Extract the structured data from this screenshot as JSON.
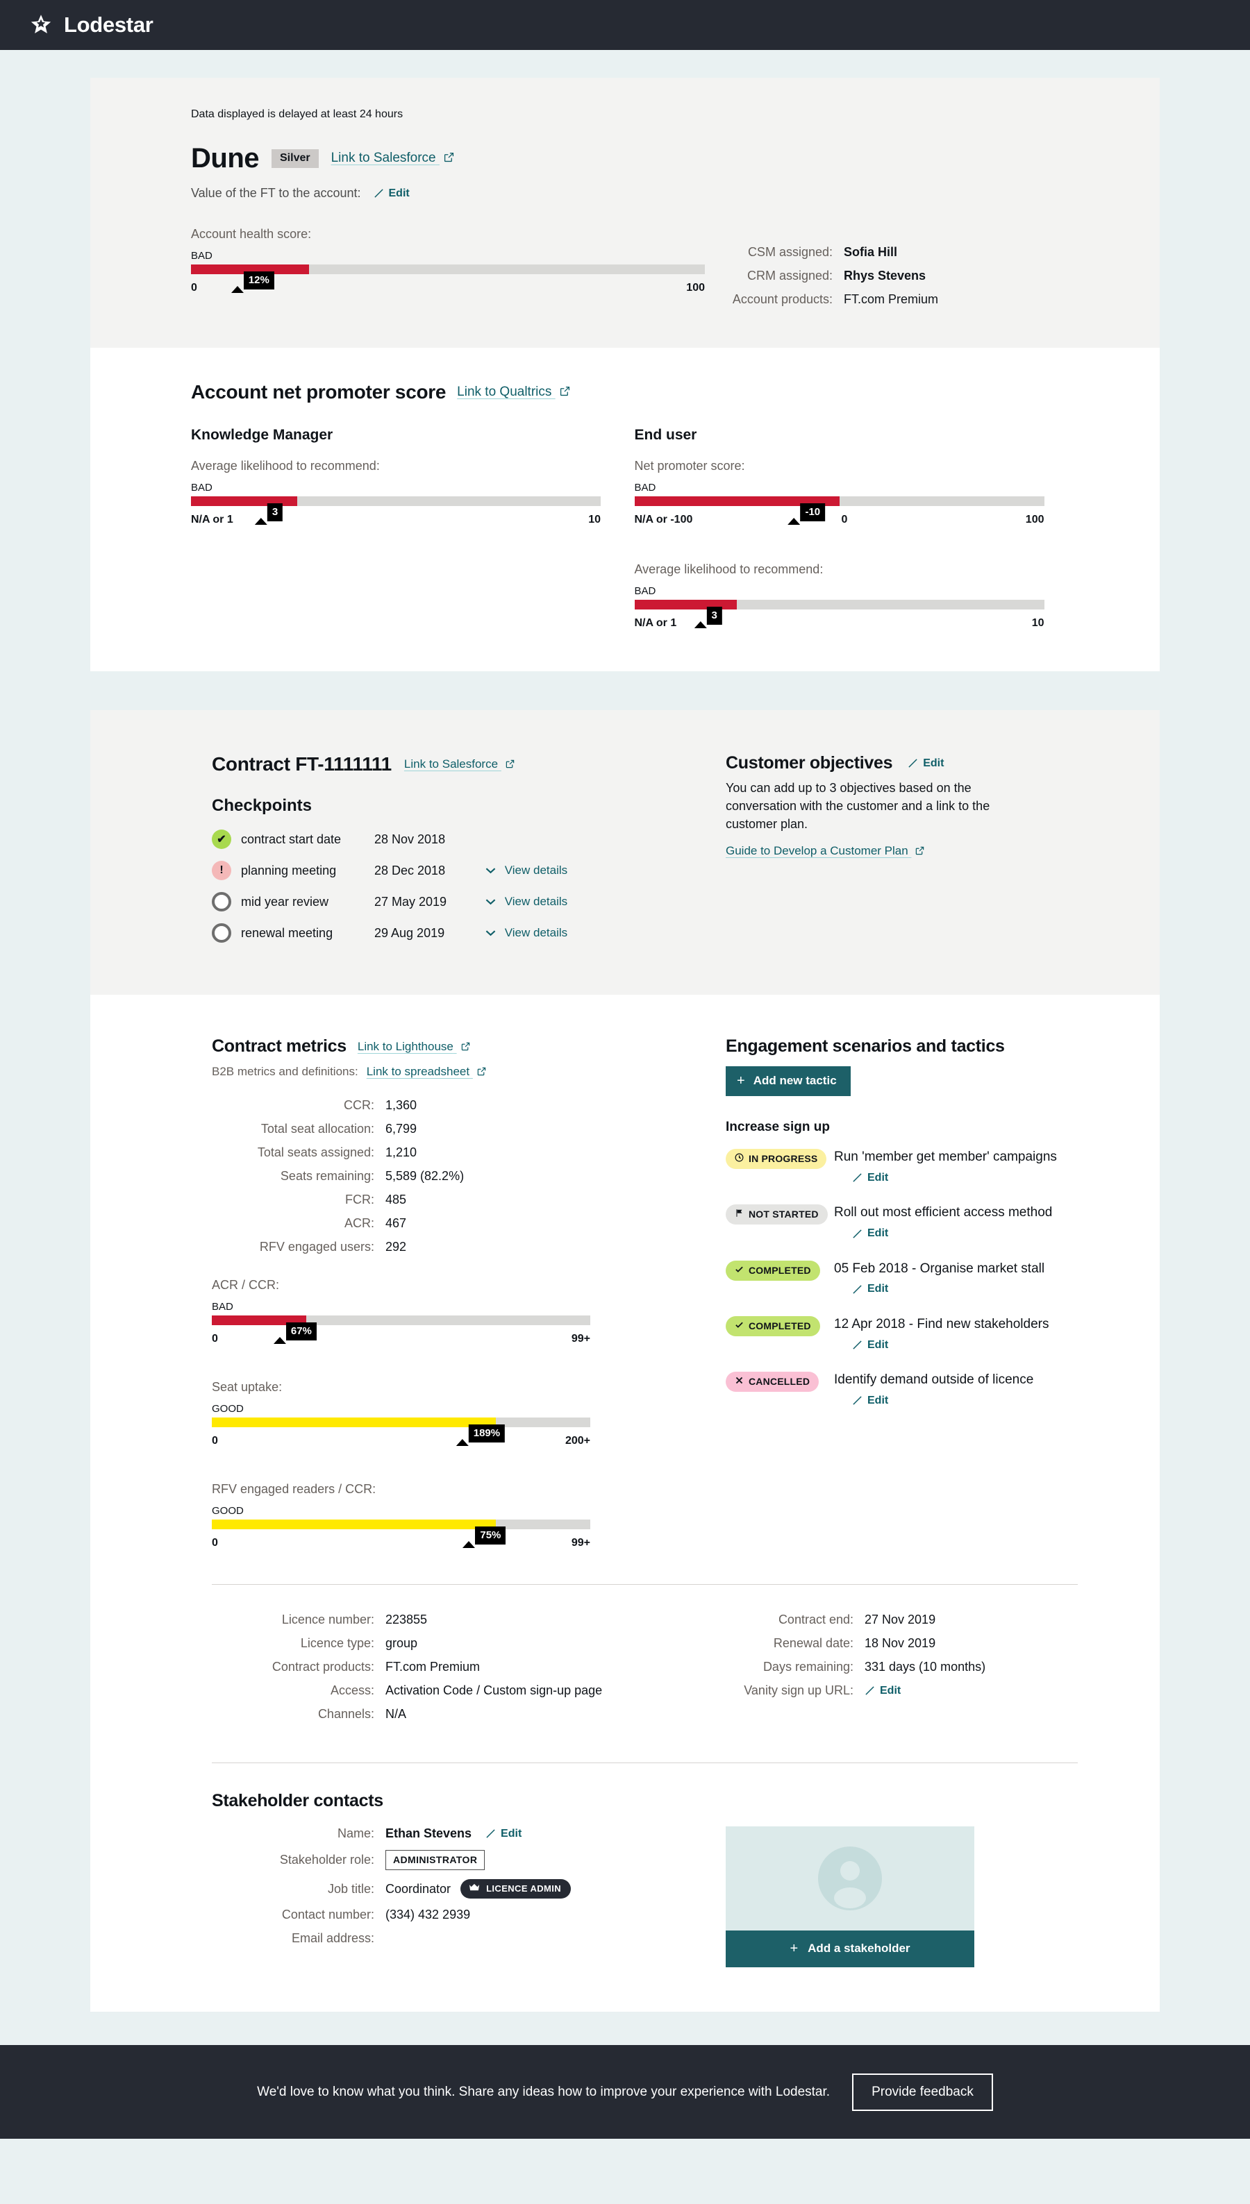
{
  "header": {
    "app_name": "Lodestar",
    "logo_icon": "star-icon"
  },
  "notice": "Data displayed is delayed at least 24 hours",
  "account": {
    "name": "Dune",
    "tier": "Silver",
    "salesforce_link": "Link to Salesforce",
    "value_label": "Value of the FT to the account:",
    "value_edit": "Edit",
    "health_caption": "Account health score:",
    "details": [
      {
        "label": "CSM assigned:",
        "value": "Sofia Hill",
        "bold": true
      },
      {
        "label": "CRM assigned:",
        "value": "Rhys Stevens",
        "bold": true
      },
      {
        "label": "Account products:",
        "value": "FT.com Premium",
        "bold": false
      }
    ]
  },
  "nps": {
    "title": "Account net promoter score",
    "qualtrics_link": "Link to Qualtrics",
    "km_heading": "Knowledge Manager",
    "enduser_heading": "End user",
    "km_caption": "Average likelihood to recommend:",
    "nps_caption": "Net promoter score:",
    "eu_avg_caption": "Average likelihood to recommend:"
  },
  "contract": {
    "title": "Contract FT-1111111",
    "salesforce_link": "Link to Salesforce",
    "checkpoints_heading": "Checkpoints",
    "checkpoints": [
      {
        "status": "done",
        "name": "contract start date",
        "date": "28 Nov 2018",
        "details": ""
      },
      {
        "status": "warn",
        "name": "planning meeting",
        "date": "28 Dec 2018",
        "details": "View details"
      },
      {
        "status": "todo",
        "name": "mid year review",
        "date": "27 May 2019",
        "details": "View details"
      },
      {
        "status": "todo",
        "name": "renewal meeting",
        "date": "29 Aug 2019",
        "details": "View details"
      }
    ]
  },
  "objectives": {
    "title": "Customer objectives",
    "edit": "Edit",
    "body": "You can add up to 3 objectives based on the conversation with the customer and a link to the customer plan.",
    "guide_link": "Guide to Develop a Customer Plan"
  },
  "metrics": {
    "title": "Contract metrics",
    "lighthouse_link": "Link to Lighthouse",
    "b2b_label": "B2B metrics and definitions:",
    "spreadsheet_link": "Link to spreadsheet",
    "rows": [
      {
        "label": "CCR:",
        "value": "1,360"
      },
      {
        "label": "Total seat allocation:",
        "value": "6,799"
      },
      {
        "label": "Total seats assigned:",
        "value": "1,210"
      },
      {
        "label": "Seats remaining:",
        "value": "5,589 (82.2%)"
      },
      {
        "label": "FCR:",
        "value": "485"
      },
      {
        "label": "ACR:",
        "value": "467"
      },
      {
        "label": "RFV engaged users:",
        "value": "292"
      }
    ]
  },
  "tactics": {
    "title": "Engagement scenarios and tactics",
    "add_button": "Add new tactic",
    "scenario": "Increase sign up",
    "edit_label": "Edit",
    "items": [
      {
        "status": "IN PROGRESS",
        "status_key": "inprogress",
        "icon": "clock-icon",
        "text": "Run 'member get member' campaigns"
      },
      {
        "status": "NOT STARTED",
        "status_key": "notstarted",
        "icon": "flag-icon",
        "text": "Roll out most efficient access method"
      },
      {
        "status": "COMPLETED",
        "status_key": "completed",
        "icon": "check-icon",
        "text": "05 Feb 2018 - Organise market stall"
      },
      {
        "status": "COMPLETED",
        "status_key": "completed",
        "icon": "check-icon",
        "text": "12 Apr 2018 - Find new stakeholders"
      },
      {
        "status": "CANCELLED",
        "status_key": "cancelled",
        "icon": "cross-icon",
        "text": "Identify demand outside of licence"
      }
    ]
  },
  "licence": {
    "left": [
      {
        "label": "Licence number:",
        "value": "223855"
      },
      {
        "label": "Licence type:",
        "value": "group"
      },
      {
        "label": "Contract products:",
        "value": "FT.com  Premium"
      },
      {
        "label": "Access:",
        "value": "Activation Code / Custom sign-up page"
      },
      {
        "label": "Channels:",
        "value": "N/A"
      }
    ],
    "right": [
      {
        "label": "Contract end:",
        "value": "27 Nov 2019"
      },
      {
        "label": "Renewal date:",
        "value": "18 Nov 2019"
      },
      {
        "label": "Days remaining:",
        "value": "331 days (10 months)"
      }
    ],
    "vanity_label": "Vanity sign up URL:",
    "vanity_edit": "Edit"
  },
  "stakeholder": {
    "title": "Stakeholder contacts",
    "name_label": "Name:",
    "name_value": "Ethan Stevens",
    "name_edit": "Edit",
    "role_label": "Stakeholder role:",
    "role_value": "ADMINISTRATOR",
    "job_label": "Job title:",
    "job_value": "Coordinator",
    "admin_badge": "LICENCE ADMIN",
    "phone_label": "Contact number:",
    "phone_value": "(334) 432 2939",
    "email_label": "Email address:",
    "email_value": "",
    "add_button": "Add a stakeholder"
  },
  "footer": {
    "text": "We'd love to know what you think. Share any ideas how to improve your experience with Lodestar.",
    "button": "Provide feedback"
  },
  "colors": {
    "brand_dark": "#262a33",
    "teal": "#1d6068",
    "bad": "#cc1933",
    "ok": "#ffe900",
    "good": "#a8d94f",
    "page_bg": "#e9f1f2"
  },
  "chart_data": [
    {
      "type": "bar",
      "id": "account-health-score",
      "title": "Account health score:",
      "rating": "BAD",
      "value": 12,
      "unit": "%",
      "label": "12%",
      "xlim": [
        0,
        100
      ],
      "min_label": "0",
      "max_label": "100",
      "fill_pct": 23,
      "pointer_pct": 12,
      "color": "#cc1933"
    },
    {
      "type": "bar",
      "id": "km-average-likelihood",
      "title": "Average likelihood to recommend:",
      "rating": "BAD",
      "value": 3,
      "label": "3",
      "xlim": [
        1,
        10
      ],
      "min_label": "N/A or 1",
      "max_label": "10",
      "fill_pct": 26,
      "pointer_pct": 18,
      "color": "#cc1933"
    },
    {
      "type": "bar",
      "id": "enduser-net-promoter-score",
      "title": "Net promoter score:",
      "rating": "BAD",
      "value": -10,
      "label": "-10",
      "xlim": [
        -100,
        100
      ],
      "min_label": "N/A or -100",
      "mid_label": "0",
      "max_label": "100",
      "fill_pct": 50,
      "pointer_pct": 42,
      "mid_pct": 50,
      "color": "#cc1933"
    },
    {
      "type": "bar",
      "id": "enduser-average-likelihood",
      "title": "Average likelihood to recommend:",
      "rating": "BAD",
      "value": 3,
      "label": "3",
      "xlim": [
        1,
        10
      ],
      "min_label": "N/A or 1",
      "max_label": "10",
      "fill_pct": 25,
      "pointer_pct": 17,
      "color": "#cc1933"
    },
    {
      "type": "bar",
      "id": "acr-ccr",
      "title": "ACR / CCR:",
      "rating": "BAD",
      "value": 67,
      "unit": "%",
      "label": "67%",
      "xlim": [
        0,
        99
      ],
      "min_label": "0",
      "max_label": "99+",
      "fill_pct": 25,
      "pointer_pct": 22,
      "color": "#cc1933"
    },
    {
      "type": "bar",
      "id": "seat-uptake",
      "title": "Seat uptake:",
      "rating": "GOOD",
      "value": 189,
      "unit": "%",
      "label": "189%",
      "xlim": [
        0,
        200
      ],
      "min_label": "0",
      "max_label": "200+",
      "fill_pct": 75,
      "pointer_pct": 70,
      "color": "#ffe900"
    },
    {
      "type": "bar",
      "id": "rfv-engaged-readers-ccr",
      "title": "RFV engaged readers / CCR:",
      "rating": "GOOD",
      "value": 75,
      "unit": "%",
      "label": "75%",
      "xlim": [
        0,
        99
      ],
      "min_label": "0",
      "max_label": "99+",
      "fill_pct": 75,
      "pointer_pct": 71,
      "color": "#ffe900"
    }
  ]
}
